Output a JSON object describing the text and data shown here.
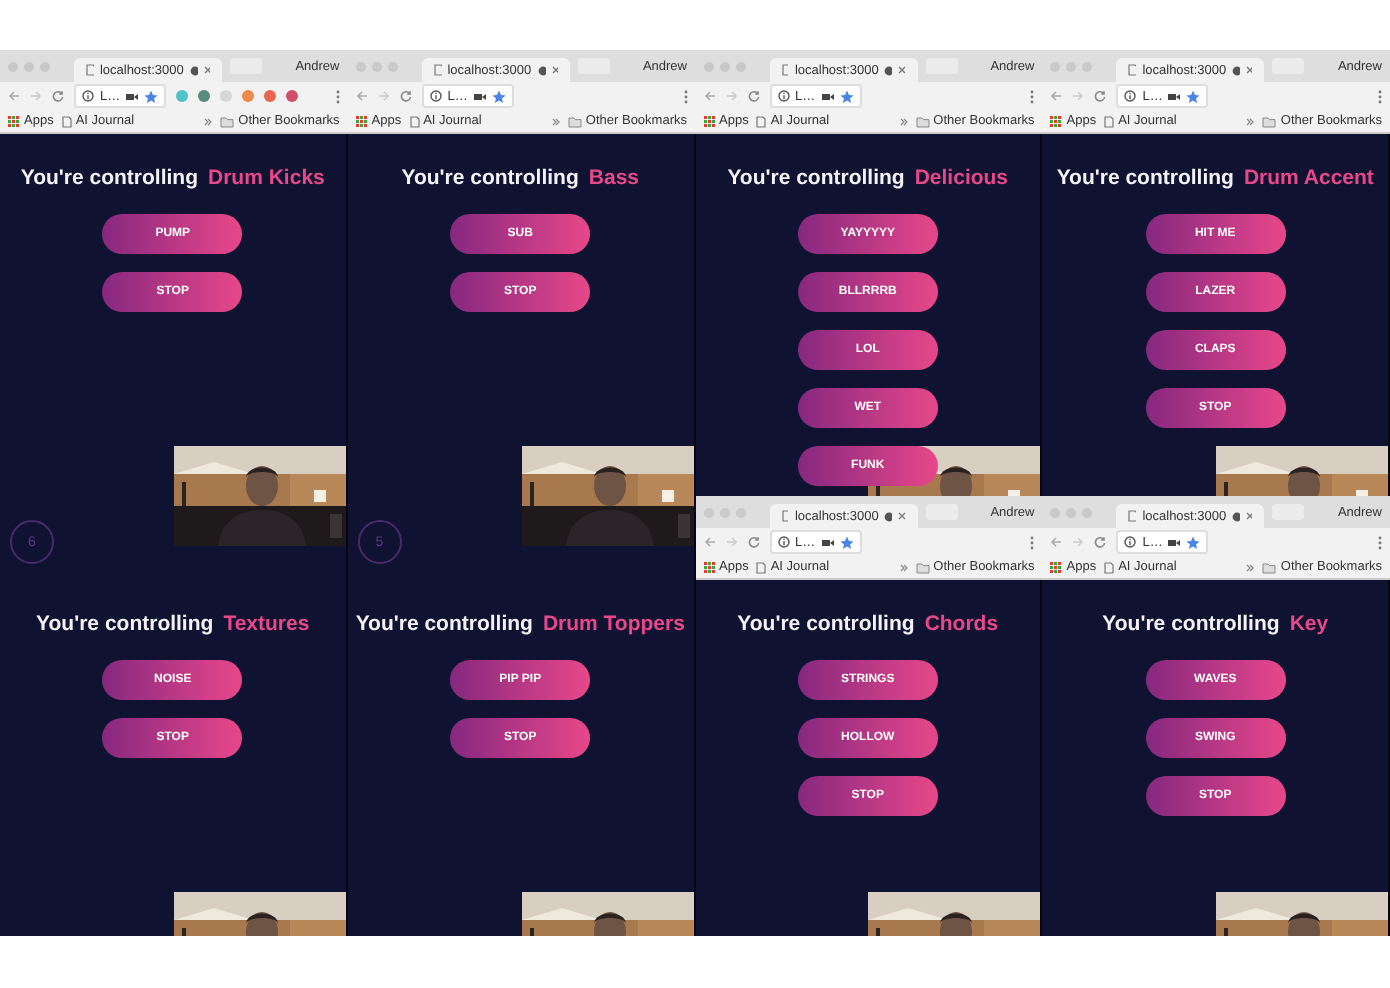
{
  "columns": [
    {
      "windows": [
        {
          "chrome": {
            "tab_title": "localhost:3000",
            "profile": "Andrew",
            "url": "L…",
            "extensions": [
              {
                "color": "#4fc3c7"
              },
              {
                "color": "#5b8a7e"
              },
              {
                "color": "#d6d6d6"
              },
              {
                "color": "#f08a4b"
              },
              {
                "color": "#e8664a"
              },
              {
                "color": "#d0506a"
              }
            ],
            "bookmarks": [
              {
                "label": "Apps",
                "kind": "apps"
              },
              {
                "label": "AI Journal",
                "kind": "page"
              },
              {
                "label": "Other Bookmarks",
                "kind": "folder"
              }
            ]
          },
          "app": {
            "prefix": "You're controlling",
            "instrument": "Drum Kicks",
            "buttons": [
              "PUMP",
              "STOP"
            ],
            "counter": "6",
            "webcam": {
              "kind": "picture"
            }
          }
        },
        {
          "app": {
            "prefix": "You're controlling",
            "instrument": "Textures",
            "buttons": [
              "NOISE",
              "STOP"
            ],
            "webcam": {
              "kind": "picture"
            }
          }
        }
      ]
    },
    {
      "windows": [
        {
          "chrome": {
            "tab_title": "localhost:3000",
            "profile": "Andrew",
            "url": "L…",
            "bookmarks": [
              {
                "label": "Apps",
                "kind": "apps"
              },
              {
                "label": "AI Journal",
                "kind": "page"
              },
              {
                "label": "Other Bookmarks",
                "kind": "folder"
              }
            ]
          },
          "app": {
            "prefix": "You're controlling",
            "instrument": "Bass",
            "buttons": [
              "SUB",
              "STOP"
            ],
            "counter": "5",
            "webcam": {
              "kind": "picture"
            }
          }
        },
        {
          "app": {
            "prefix": "You're controlling",
            "instrument": "Drum Toppers",
            "buttons": [
              "PIP PIP",
              "STOP"
            ],
            "webcam": {
              "kind": "picture"
            }
          }
        }
      ]
    },
    {
      "windows": [
        {
          "chrome": {
            "tab_title": "localhost:3000",
            "profile": "Andrew",
            "url": "L…",
            "bookmarks": [
              {
                "label": "Apps",
                "kind": "apps"
              },
              {
                "label": "AI Journal",
                "kind": "page"
              },
              {
                "label": "Other Bookmarks",
                "kind": "folder"
              }
            ]
          },
          "app": {
            "prefix": "You're controlling",
            "instrument": "Delicious",
            "buttons": [
              "YAYYYYY",
              "BLLRRRB",
              "LOL",
              "WET",
              "FUNK"
            ],
            "webcam": {
              "kind": "picture"
            }
          }
        },
        {
          "chrome": {
            "tab_title": "localhost:3000",
            "profile": "Andrew",
            "url": "L…",
            "bookmarks": [
              {
                "label": "Apps",
                "kind": "apps"
              },
              {
                "label": "AI Journal",
                "kind": "page"
              },
              {
                "label": "Other Bookmarks",
                "kind": "folder"
              }
            ]
          },
          "app": {
            "prefix": "You're controlling",
            "instrument": "Chords",
            "buttons": [
              "STRINGS",
              "HOLLOW",
              "STOP"
            ],
            "webcam": {
              "kind": "picture"
            }
          }
        }
      ]
    },
    {
      "windows": [
        {
          "chrome": {
            "tab_title": "localhost:3000",
            "profile": "Andrew",
            "url": "L…",
            "bookmarks": [
              {
                "label": "Apps",
                "kind": "apps"
              },
              {
                "label": "AI Journal",
                "kind": "page"
              },
              {
                "label": "Other Bookmarks",
                "kind": "folder"
              }
            ]
          },
          "app": {
            "prefix": "You're controlling",
            "instrument": "Drum Accent",
            "buttons": [
              "HIT ME",
              "LAZER",
              "CLAPS",
              "STOP"
            ],
            "webcam": {
              "kind": "picture"
            }
          }
        },
        {
          "chrome": {
            "tab_title": "localhost:3000",
            "profile": "Andrew",
            "url": "L…",
            "bookmarks": [
              {
                "label": "Apps",
                "kind": "apps"
              },
              {
                "label": "AI Journal",
                "kind": "page"
              },
              {
                "label": "Other Bookmarks",
                "kind": "folder"
              }
            ]
          },
          "app": {
            "prefix": "You're controlling",
            "instrument": "Key",
            "buttons": [
              "WAVES",
              "SWING",
              "STOP"
            ],
            "webcam": {
              "kind": "picture"
            }
          }
        }
      ]
    }
  ]
}
